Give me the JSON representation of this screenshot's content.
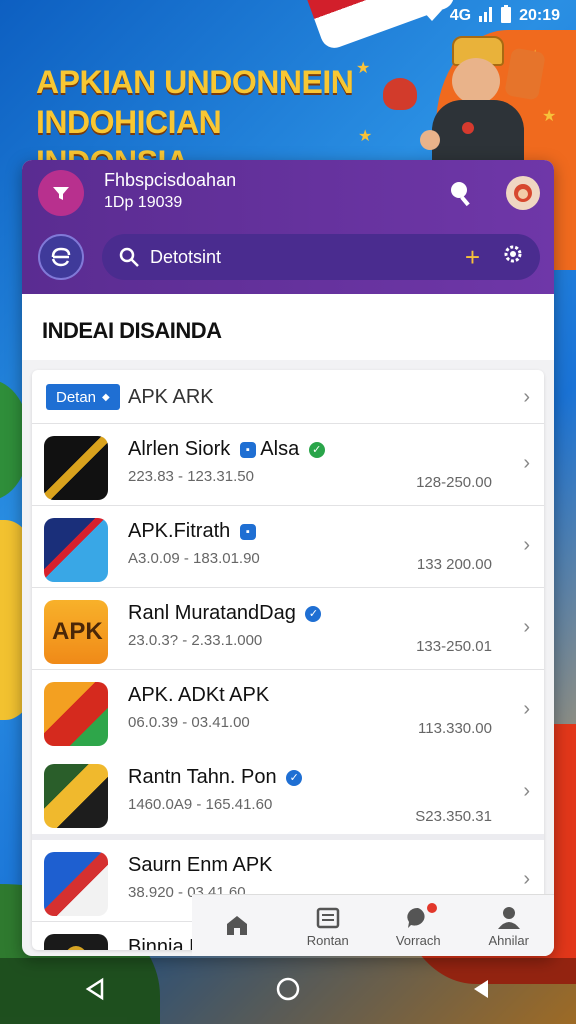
{
  "status_bar": {
    "time": "20:19",
    "network": "4G"
  },
  "banner": {
    "line1": "APKIAN UNDONNEIN",
    "line2": "INDOHICIAN INDONSIA"
  },
  "header": {
    "title": "Fhbspcisdoahan",
    "subtitle": "1Dp 19039",
    "search_placeholder": "Detotsint"
  },
  "section": {
    "title": "INDEAI DISAINDA"
  },
  "filter": {
    "chip_label": "Detan",
    "label": "APK ARK"
  },
  "apps": [
    {
      "name": "Alrlen Siork",
      "name_suffix": "Alsa",
      "sub": "223.83 - 123.31.50",
      "size": "128-250.00"
    },
    {
      "name": "APK.Fitrath",
      "name_suffix": "",
      "sub": "A3.0.09 - 183.01.90",
      "size": "133 200.00"
    },
    {
      "name": "Ranl MuratandDag",
      "name_suffix": "",
      "sub": "23.0.3? - 2.33.1.000",
      "size": "133-250.01"
    },
    {
      "name": "APK. ADKt APK",
      "name_suffix": "",
      "sub": "06.0.39 - 03.41.00",
      "size": "113.330.00"
    },
    {
      "name": "Rantn Tahn. Pon",
      "name_suffix": "",
      "sub": "1460.0A9 - 165.41.60",
      "size": "S23.350.31"
    },
    {
      "name": "Saurn Enm APK",
      "name_suffix": "",
      "sub": "38.920 - 03.41.60",
      "size": ""
    },
    {
      "name": "Binnia Daneben.",
      "name_suffix": "",
      "sub": "",
      "size": ""
    }
  ],
  "bottom_nav": [
    {
      "label": "",
      "icon": "home-icon"
    },
    {
      "label": "Rontan",
      "icon": "news-icon"
    },
    {
      "label": "Vorrach",
      "icon": "chat-icon"
    },
    {
      "label": "Ahnilar",
      "icon": "profile-icon"
    }
  ],
  "colors": {
    "header": "#5a2c91",
    "accent": "#1f6fd3",
    "banner_text": "#f8c733"
  }
}
